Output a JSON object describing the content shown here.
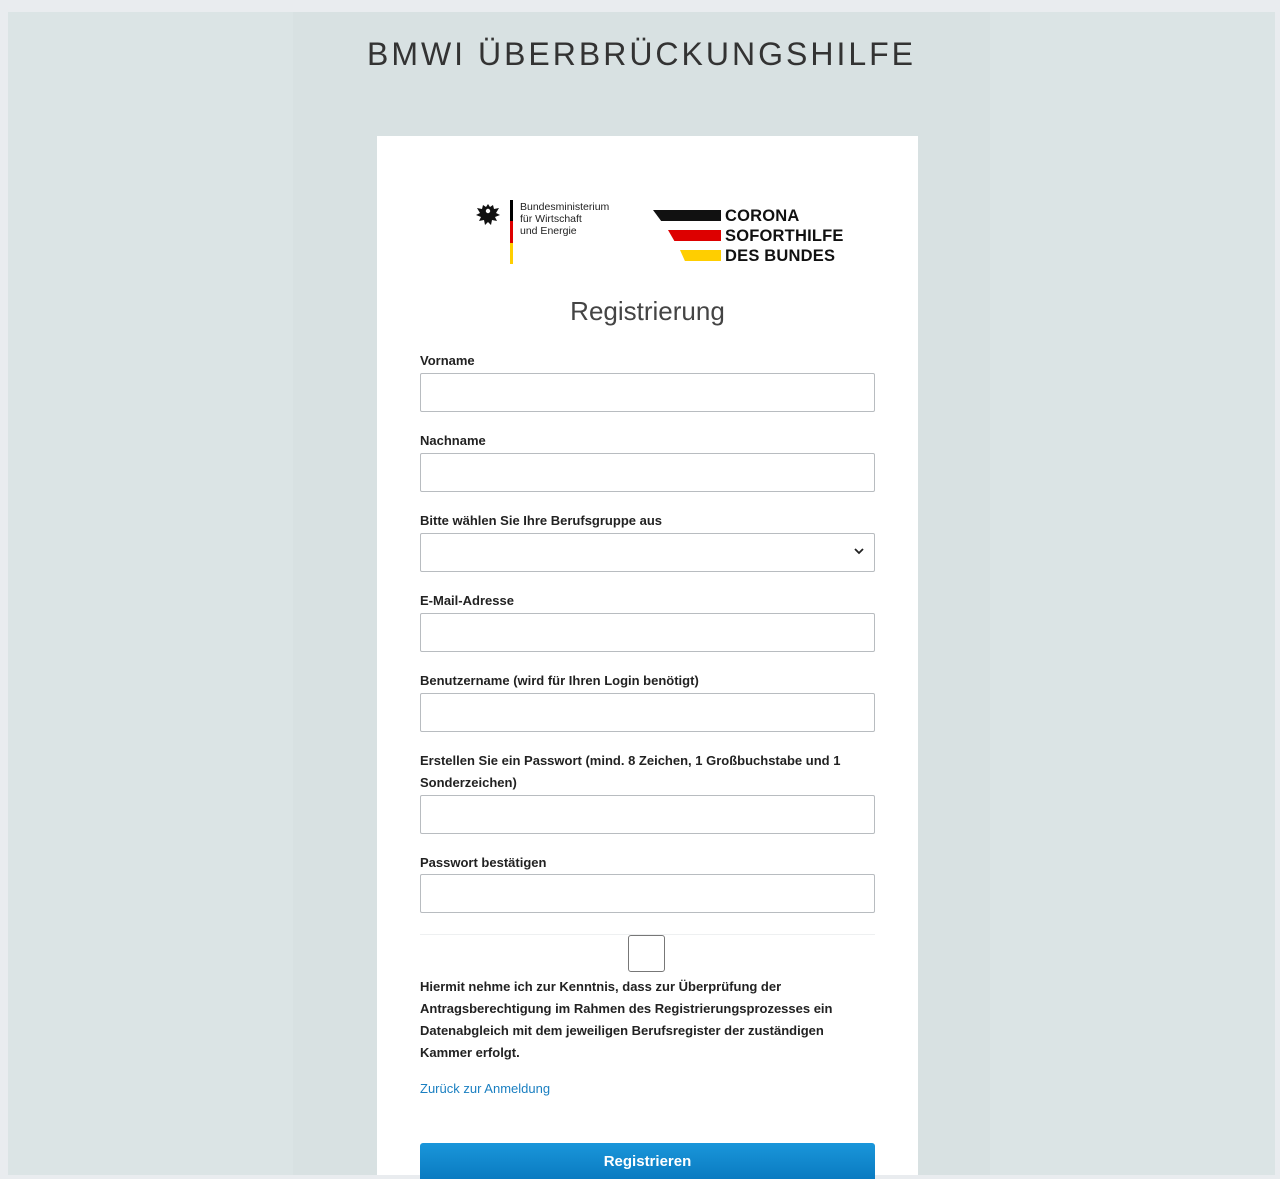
{
  "page": {
    "title": "BMWI ÜBERBRÜCKUNGSHILFE"
  },
  "logos": {
    "bmwi": {
      "line1": "Bundesministerium",
      "line2": "für Wirtschaft",
      "line3": "und Energie",
      "icon": "federal-eagle-icon"
    },
    "corona": {
      "line1": "CORONA",
      "line2": "SOFORTHILFE",
      "line3": "DES BUNDES"
    }
  },
  "colors": {
    "flag_black": "#000000",
    "flag_red": "#dd0000",
    "flag_gold": "#ffce00",
    "link": "#1a7fc1",
    "button": "#0a7bc1"
  },
  "form": {
    "title": "Registrierung",
    "fields": [
      {
        "label": "Vorname",
        "value": "",
        "placeholder": ""
      },
      {
        "label": "Nachname",
        "value": "",
        "placeholder": ""
      },
      {
        "label": "Bitte wählen Sie Ihre Berufsgruppe aus",
        "value": "",
        "type": "select"
      },
      {
        "label": "E-Mail-Adresse",
        "value": "",
        "placeholder": ""
      },
      {
        "label": "Benutzername (wird für Ihren Login benötigt)",
        "value": "",
        "placeholder": ""
      },
      {
        "label": "Erstellen Sie ein Passwort (mind. 8 Zeichen, 1 Großbuchstabe und 1 Sonderzeichen)",
        "value": "",
        "placeholder": ""
      },
      {
        "label": "Passwort bestätigen",
        "value": "",
        "placeholder": ""
      }
    ],
    "consent_text": "Hiermit nehme ich zur Kenntnis, dass zur Überprüfung der Antragsberechtigung im Rahmen des Registrierungsprozesses ein Datenabgleich mit dem jeweiligen Berufsregister der zuständigen Kammer erfolgt.",
    "back_link": "Zurück zur Anmeldung",
    "submit_label": "Registrieren"
  }
}
